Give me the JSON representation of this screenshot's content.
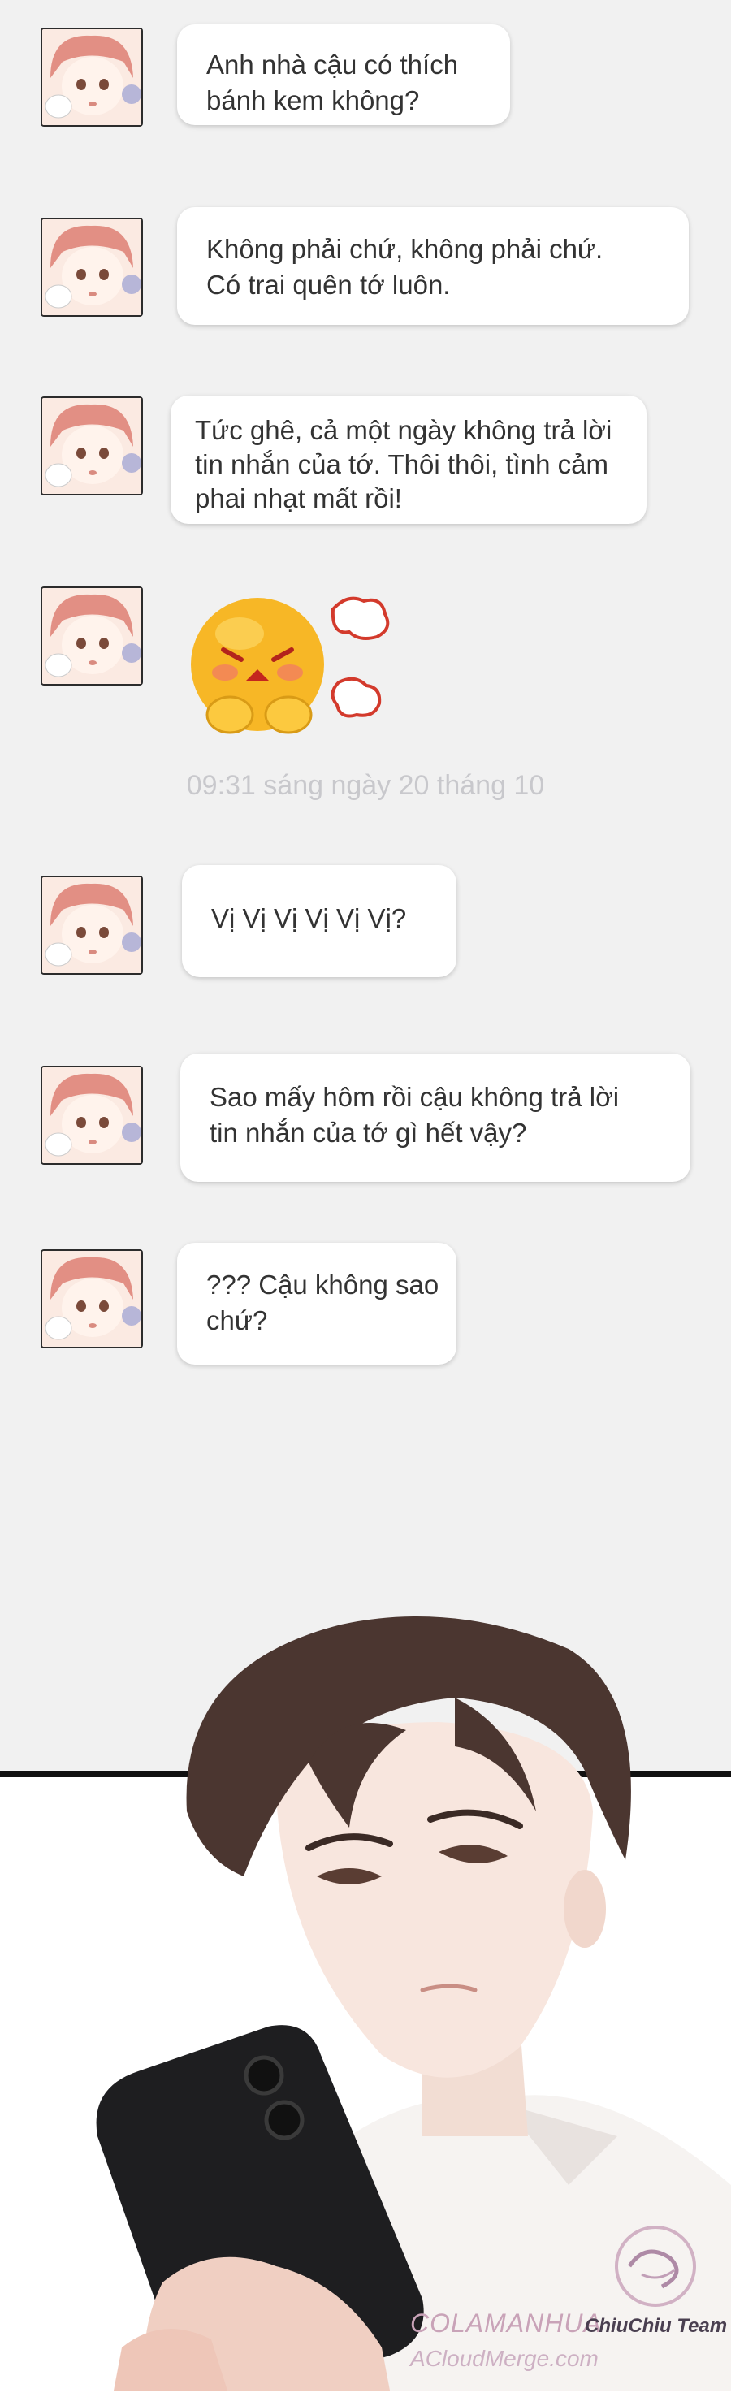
{
  "messages": [
    {
      "lines": [
        "Anh nhà cậu có thích",
        "bánh kem không?"
      ]
    },
    {
      "lines": [
        "Không phải chứ, không phải chứ.",
        "Có trai quên tớ luôn."
      ]
    },
    {
      "lines": [
        "Tức ghê, cả một ngày không trả lời",
        "tin nhắn của tớ. Thôi thôi, tình cảm",
        "phai nhạt mất rồi!"
      ]
    },
    {
      "sticker": "angry-emoji-sticker"
    },
    {
      "lines": [
        "Vị Vị Vị Vị Vị Vị?"
      ]
    },
    {
      "lines": [
        "Sao mấy hôm rồi cậu không trả lời",
        "tin nhắn của tớ gì hết vậy?"
      ]
    },
    {
      "lines": [
        "??? Cậu không sao",
        "chứ?"
      ]
    }
  ],
  "timestamp": "09:31 sáng ngày 20 tháng 10",
  "watermarks": {
    "colamanhua": "COLAMANHUA",
    "team": "ChiuChiu Team",
    "site": "ACloudMerge.com"
  },
  "colors": {
    "chat_background": "#f1f1f1",
    "bubble": "#ffffff",
    "text": "#333333",
    "timestamp": "#c8c8cc",
    "emoji": "#f7b726"
  }
}
